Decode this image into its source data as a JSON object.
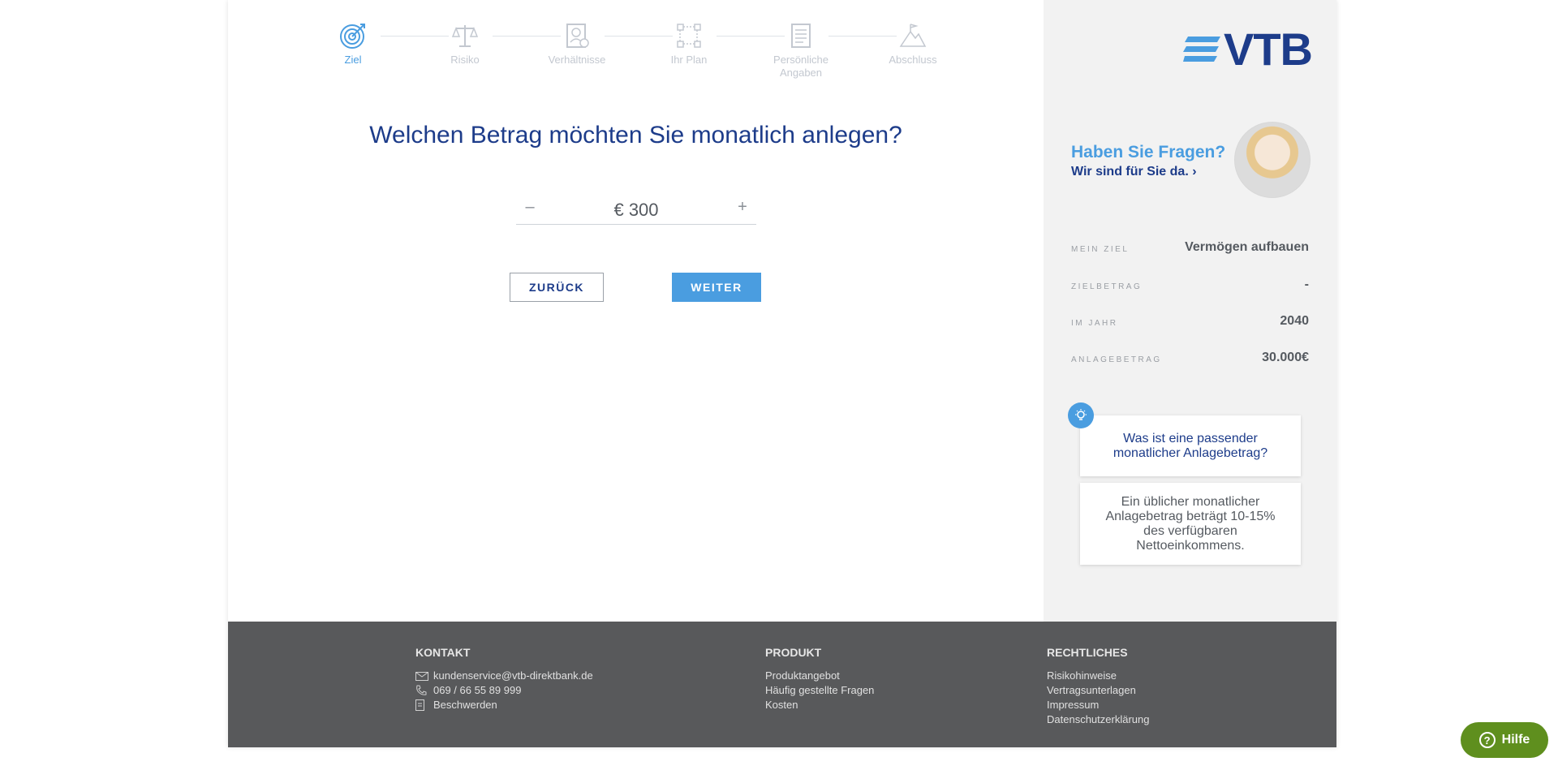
{
  "colors": {
    "accent": "#4a9de0",
    "brand": "#1d3c8a",
    "footer_bg": "#58595b",
    "help_button": "#5f8f1e"
  },
  "stepper": {
    "steps": [
      {
        "label": "Ziel",
        "icon": "target-icon",
        "active": true
      },
      {
        "label": "Risiko",
        "icon": "scale-icon",
        "active": false
      },
      {
        "label": "Verhältnisse",
        "icon": "profile-document-icon",
        "active": false
      },
      {
        "label": "Ihr Plan",
        "icon": "flowchart-icon",
        "active": false
      },
      {
        "label": "Persönliche Angaben",
        "icon": "document-icon",
        "active": false
      },
      {
        "label": "Abschluss",
        "icon": "mountain-flag-icon",
        "active": false
      }
    ]
  },
  "main": {
    "question": "Welchen Betrag möchten Sie monatlich anlegen?",
    "amount": {
      "minus": "–",
      "value": "€ 300",
      "plus": "+"
    },
    "back_label": "ZURÜCK",
    "next_label": "WEITER"
  },
  "sidebar": {
    "logo_text": "VTB",
    "help_title": "Haben Sie Fragen?",
    "help_sub": "Wir sind für Sie da. ›",
    "summary": [
      {
        "key": "MEIN ZIEL",
        "value": "Vermögen aufbauen"
      },
      {
        "key": "ZIELBETRAG",
        "value": "-"
      },
      {
        "key": "IM JAHR",
        "value": "2040"
      },
      {
        "key": "ANLAGEBETRAG",
        "value": "30.000€"
      }
    ],
    "tip_question": "Was ist eine passender monatlicher Anlagebetrag?",
    "tip_answer": "Ein üblicher monatlicher Anlagebetrag beträgt 10-15% des verfügbaren Nettoeinkommens."
  },
  "footer": {
    "kontakt": {
      "title": "KONTAKT",
      "email": "kundenservice@vtb-direktbank.de",
      "phone": "069 / 66 55 89 999",
      "complaints": "Beschwerden"
    },
    "produkt": {
      "title": "PRODUKT",
      "items": [
        "Produktangebot",
        "Häufig gestellte Fragen",
        "Kosten"
      ]
    },
    "rechtliches": {
      "title": "RECHTLICHES",
      "items": [
        "Risikohinweise",
        "Vertragsunterlagen",
        "Impressum",
        "Datenschutzerklärung"
      ]
    }
  },
  "help_button": {
    "label": "Hilfe"
  }
}
